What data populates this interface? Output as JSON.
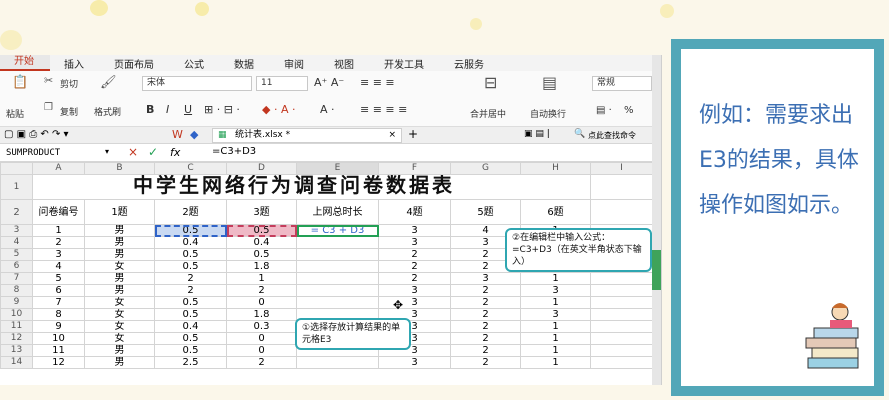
{
  "menu_tabs": [
    "开始",
    "插入",
    "页面布局",
    "公式",
    "数据",
    "审阅",
    "视图",
    "开发工具",
    "云服务"
  ],
  "ribbon": {
    "paste": "粘贴",
    "cut": "剪切",
    "copy": "复制",
    "format_painter": "格式刷",
    "font_name": "宋体",
    "font_size": "11",
    "bold": "B",
    "italic": "I",
    "underline": "U",
    "merge_center": "合并居中",
    "wrap_text": "自动换行",
    "number_format": "常规",
    "percent": "%"
  },
  "file_tab": "统计表.xlsx *",
  "search_command": "点此查找命令",
  "name_box": "SUMPRODUCT",
  "formula_bar": {
    "fx": "fx",
    "content": "=C3+D3"
  },
  "columns": [
    "A",
    "B",
    "C",
    "D",
    "E",
    "F",
    "G",
    "H",
    "I"
  ],
  "sheet_title": "中学生网络行为调查问卷数据表",
  "headers": [
    "问卷编号",
    "1题",
    "2题",
    "3题",
    "上网总时长",
    "4题",
    "5题",
    "6题"
  ],
  "rows": [
    {
      "n": "3",
      "cells": [
        "1",
        "男",
        "0.5",
        "0.5",
        "= C3 + D3",
        "3",
        "4",
        "1",
        ""
      ]
    },
    {
      "n": "4",
      "cells": [
        "2",
        "男",
        "0.4",
        "0.4",
        "",
        "3",
        "3",
        "1",
        ""
      ]
    },
    {
      "n": "5",
      "cells": [
        "3",
        "男",
        "0.5",
        "0.5",
        "",
        "2",
        "2",
        "1",
        ""
      ]
    },
    {
      "n": "6",
      "cells": [
        "4",
        "女",
        "0.5",
        "1.8",
        "",
        "2",
        "2",
        "1",
        ""
      ]
    },
    {
      "n": "7",
      "cells": [
        "5",
        "男",
        "2",
        "1",
        "",
        "2",
        "3",
        "1",
        ""
      ]
    },
    {
      "n": "8",
      "cells": [
        "6",
        "男",
        "2",
        "2",
        "",
        "3",
        "2",
        "3",
        ""
      ]
    },
    {
      "n": "9",
      "cells": [
        "7",
        "女",
        "0.5",
        "0",
        "",
        "3",
        "2",
        "1",
        ""
      ]
    },
    {
      "n": "10",
      "cells": [
        "8",
        "女",
        "0.5",
        "1.8",
        "",
        "3",
        "2",
        "3",
        ""
      ]
    },
    {
      "n": "11",
      "cells": [
        "9",
        "女",
        "0.4",
        "0.3",
        "",
        "3",
        "2",
        "1",
        ""
      ]
    },
    {
      "n": "12",
      "cells": [
        "10",
        "女",
        "0.5",
        "0",
        "",
        "3",
        "2",
        "1",
        ""
      ]
    },
    {
      "n": "13",
      "cells": [
        "11",
        "男",
        "0.5",
        "0",
        "",
        "3",
        "2",
        "1",
        ""
      ]
    },
    {
      "n": "14",
      "cells": [
        "12",
        "男",
        "2.5",
        "2",
        "",
        "3",
        "2",
        "1",
        ""
      ]
    }
  ],
  "callout_formula": "②在编辑栏中输入公式：=C3+D3（在英文半角状态下输入）",
  "callout_cell": "①选择存放计算结果的单元格E3",
  "instruction": "例如：需要求出E3的结果，具体操作如图如示。",
  "colors": {
    "teal_border": "#52a7b8",
    "instruction_text": "#3c6fb3",
    "active_tab": "#c2361f"
  }
}
